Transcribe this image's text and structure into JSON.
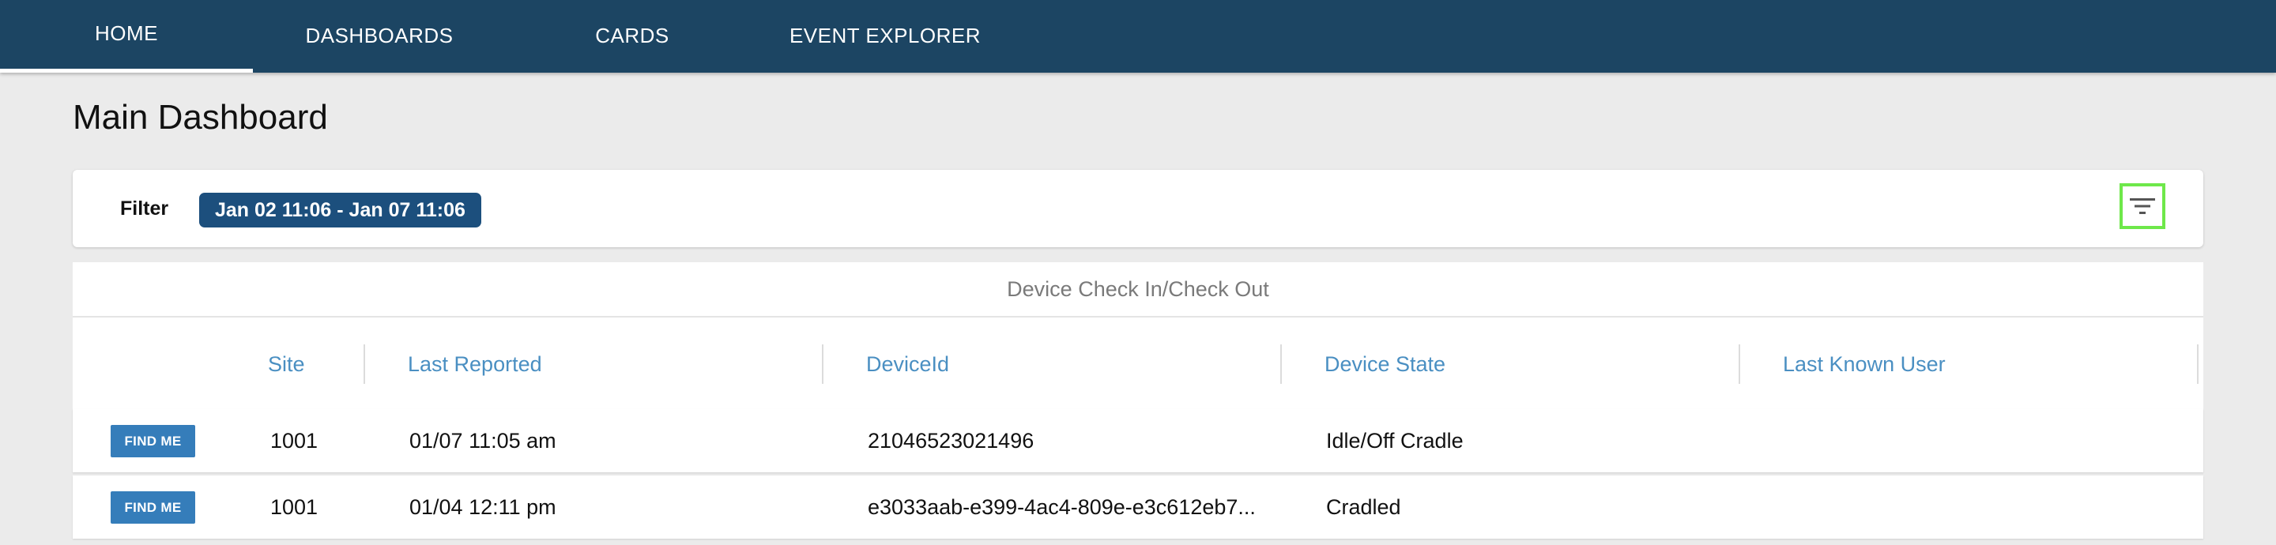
{
  "nav": {
    "tabs": [
      {
        "label": "HOME",
        "active": true
      },
      {
        "label": "DASHBOARDS",
        "active": false
      },
      {
        "label": "CARDS",
        "active": false
      },
      {
        "label": "EVENT EXPLORER",
        "active": false
      }
    ]
  },
  "page": {
    "title": "Main Dashboard"
  },
  "filter": {
    "label": "Filter",
    "range": "Jan 02 11:06 - Jan 07 11:06",
    "toggle_icon": "filter-list-icon"
  },
  "card": {
    "title": "Device Check In/Check Out",
    "columns": [
      "Site",
      "Last Reported",
      "DeviceId",
      "Device State",
      "Last Known User"
    ],
    "rows": [
      {
        "action": "FIND ME",
        "site": "1001",
        "last_reported": "01/07 11:05 am",
        "device_id": "21046523021496",
        "device_state": "Idle/Off Cradle",
        "last_known_user": ""
      },
      {
        "action": "FIND ME",
        "site": "1001",
        "last_reported": "01/04 12:11 pm",
        "device_id": "e3033aab-e399-4ac4-809e-e3c612eb7...",
        "device_state": "Cradled",
        "last_known_user": ""
      }
    ]
  },
  "colors": {
    "nav_bg": "#1c4563",
    "chip_bg": "#1c4f7d",
    "header_text": "#4a8fc2",
    "button_bg": "#357dba",
    "highlight": "#6ee84a"
  }
}
